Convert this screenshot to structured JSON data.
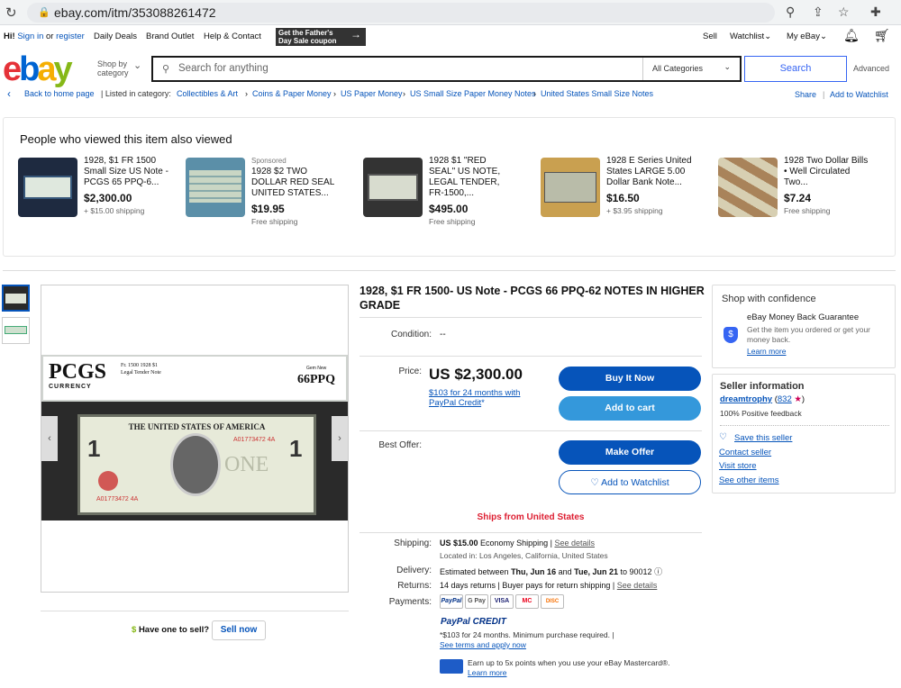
{
  "browser": {
    "url": "ebay.com/itm/353088261472"
  },
  "topbar": {
    "hi": "Hi!",
    "sign_in": "Sign in",
    "or": "or",
    "register": "register",
    "daily_deals": "Daily Deals",
    "brand_outlet": "Brand Outlet",
    "help": "Help & Contact",
    "coupon_line1": "Get the Father's",
    "coupon_line2": "Day Sale coupon",
    "sell": "Sell",
    "watchlist": "Watchlist",
    "my_ebay": "My eBay"
  },
  "header": {
    "logo": [
      "e",
      "b",
      "a",
      "y"
    ],
    "shop_by_1": "Shop by",
    "shop_by_2": "category",
    "search_placeholder": "Search for anything",
    "category": "All Categories",
    "search_button": "Search",
    "advanced": "Advanced"
  },
  "breadcrumb": {
    "back": "Back to home page",
    "listed_in": "Listed in category:",
    "items": [
      "Collectibles & Art",
      "Coins & Paper Money",
      "US Paper Money",
      "US Small Size Paper Money Notes",
      "United States Small Size Notes"
    ],
    "share": "Share",
    "add_watchlist": "Add to Watchlist"
  },
  "also_viewed": {
    "title": "People who viewed this item also viewed",
    "items": [
      {
        "sponsored": "",
        "title": "1928, $1 FR 1500 Small Size US Note - PCGS 65 PPQ-6...",
        "price": "$2,300.00",
        "shipping": "+ $15.00 shipping"
      },
      {
        "sponsored": "Sponsored",
        "title": "1928 $2 TWO DOLLAR RED SEAL UNITED STATES...",
        "price": "$19.95",
        "shipping": "Free shipping"
      },
      {
        "sponsored": "",
        "title": "1928 $1 \"RED SEAL\" US NOTE, LEGAL TENDER, FR-1500,...",
        "price": "$495.00",
        "shipping": "Free shipping"
      },
      {
        "sponsored": "",
        "title": "1928 E Series United States LARGE 5.00 Dollar Bank Note...",
        "price": "$16.50",
        "shipping": "+ $3.95 shipping"
      },
      {
        "sponsored": "",
        "title": "1928 Two Dollar Bills • Well Circulated Two...",
        "price": "$7.24",
        "shipping": "Free shipping"
      }
    ]
  },
  "gallery": {
    "pcgs": "PCGS",
    "currency": "CURRENCY",
    "grade_small": "Gem New",
    "grade": "66PPQ",
    "note_line1": "Fr. 1500 1928 $1",
    "note_line2": "Legal Tender Note",
    "banner": "THE UNITED STATES OF AMERICA",
    "serial": "A01773472 4A",
    "denomination": "ONE",
    "numeral": "1",
    "have_one": "Have one to sell?",
    "sell_now": "Sell now"
  },
  "item": {
    "title": "1928, $1 FR 1500- US Note - PCGS 66 PPQ-62 NOTES IN HIGHER GRADE",
    "condition_label": "Condition:",
    "condition_value": "--",
    "price_label": "Price:",
    "price": "US $2,300.00",
    "paypal_credit_1": "$103 for 24 months with",
    "paypal_credit_2": "PayPal Credit",
    "buy_now": "Buy It Now",
    "add_cart": "Add to cart",
    "best_offer_label": "Best Offer:",
    "make_offer": "Make Offer",
    "add_watchlist": "Add to Watchlist",
    "ships_from": "Ships from United States",
    "shipping_label": "Shipping:",
    "shipping_value": "US $15.00",
    "shipping_type": "Economy Shipping |",
    "see_details": "See details",
    "located_in": "Located in: Los Angeles, California, United States",
    "delivery_label": "Delivery:",
    "delivery_value": "Estimated between",
    "delivery_dates": "Thu, Jun 16",
    "delivery_and": "and",
    "delivery_end": "Tue, Jun 21",
    "delivery_to": "to 90012",
    "returns_label": "Returns:",
    "returns_value": "14 days returns | Buyer pays for return shipping |",
    "returns_details": "See details",
    "payments_label": "Payments:",
    "payment_methods": [
      "PayPal",
      "G Pay",
      "VISA",
      "MC",
      "DISC"
    ],
    "pp_credit_logo": "PayPal CREDIT",
    "pp_terms": "*$103 for 24 months. Minimum purchase required. |",
    "pp_terms_link": "See terms and apply now",
    "card_text": "Earn up to 5x points when you use your eBay Mastercard®.",
    "card_learn": "Learn more"
  },
  "confidence": {
    "title": "Shop with confidence",
    "guarantee": "eBay Money Back Guarantee",
    "desc": "Get the item you ordered or get your money back.",
    "learn": "Learn more"
  },
  "seller": {
    "title": "Seller information",
    "name": "dreamtrophy",
    "score": "832",
    "feedback": "100% Positive feedback",
    "save": "Save this seller",
    "contact": "Contact seller",
    "visit": "Visit store",
    "other": "See other items"
  },
  "colors": {
    "accent": "#0654ba",
    "ships_red": "#dd1e31"
  }
}
